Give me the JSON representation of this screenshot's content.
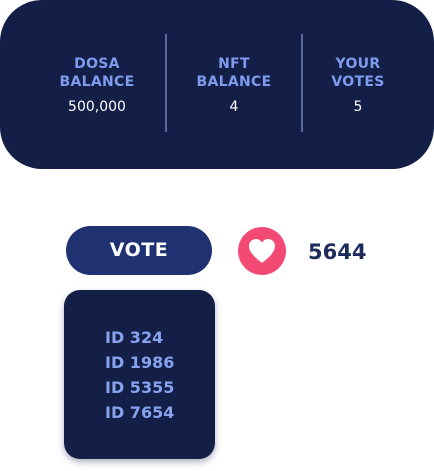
{
  "stats": [
    {
      "label": "DOSA\nBALANCE",
      "value": "500,000"
    },
    {
      "label": "NFT\nBALANCE",
      "value": "4"
    },
    {
      "label": "YOUR\nVOTES",
      "value": "5"
    }
  ],
  "actions": {
    "vote_label": "VOTE",
    "like_icon": "heart-icon",
    "like_count": "5644"
  },
  "ids": [
    "ID 324",
    "ID 1986",
    "ID 5355",
    "ID 7654"
  ],
  "colors": {
    "card_bg": "#141f48",
    "label": "#7f9bee",
    "vote_button": "#1f3170",
    "heart_bg": "#f24a75",
    "count_text": "#1e2c5c",
    "id_text": "#87a3ef"
  }
}
